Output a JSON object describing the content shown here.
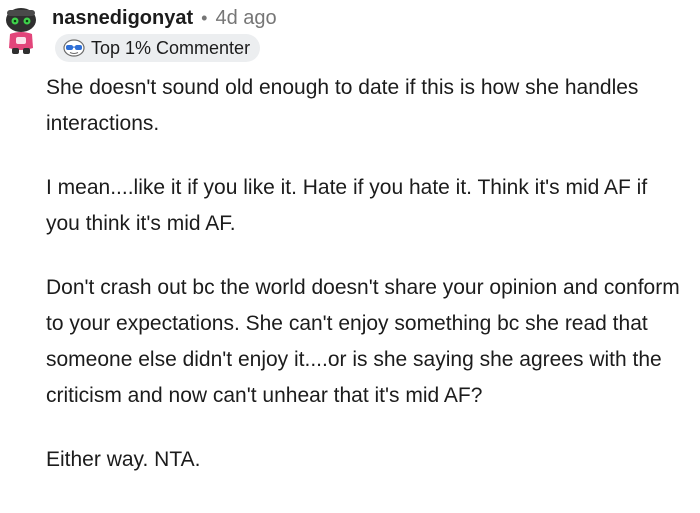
{
  "comment": {
    "username": "nasnedigonyat",
    "separator": "•",
    "timestamp": "4d ago",
    "flair": {
      "icon": "sunglasses-badge-icon",
      "text": "Top 1% Commenter"
    },
    "paragraphs": [
      "She doesn't sound old enough to date if this is how she handles interactions.",
      "I mean....like it if you like it. Hate if you hate it. Think it's mid AF if you think it's mid AF.",
      "Don't crash out bc the world doesn't share your opinion and conform to your expectations. She can't enjoy something bc she read that someone else didn't enjoy it....or is she saying she agrees with the criticism and now can't unhear that it's mid AF?",
      "Either way. NTA."
    ]
  },
  "colors": {
    "text": "#1c1c1c",
    "meta": "#767676",
    "flair_bg": "#eceef0",
    "avatar_body": "#2f2f2f",
    "avatar_accent": "#e2457a",
    "avatar_eyes": "#3fd24b"
  }
}
